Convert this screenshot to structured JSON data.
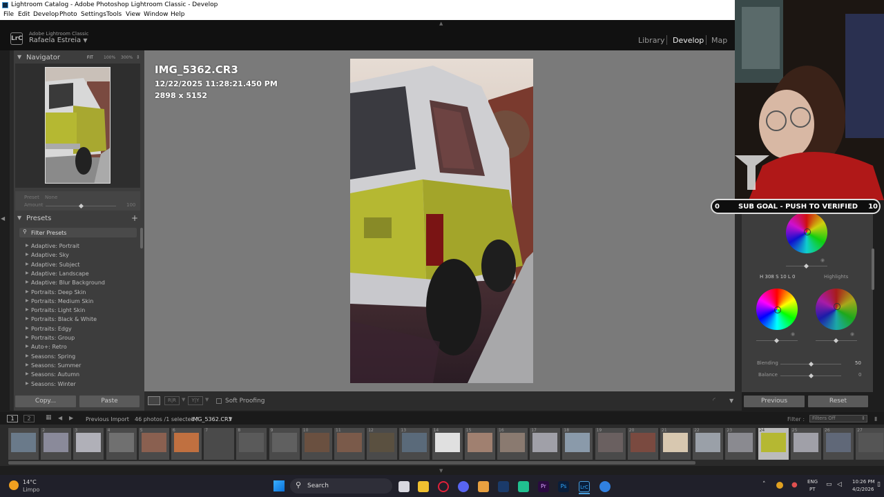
{
  "window": {
    "title": "Lightroom Catalog - Adobe Photoshop Lightroom Classic - Develop"
  },
  "menu": [
    "File",
    "Edit",
    "Develop",
    "Photo",
    "Settings",
    "Tools",
    "View",
    "Window",
    "Help"
  ],
  "identity": {
    "logo": "LrC",
    "product": "Adobe Lightroom Classic",
    "user": "Rafaela Estreia"
  },
  "modules": [
    "Library",
    "Develop",
    "Map"
  ],
  "navigator": {
    "title": "Navigator",
    "zoom": [
      "FIT",
      "100%",
      "300%"
    ]
  },
  "preset_amount": {
    "preset_label": "Preset",
    "preset_value": "None",
    "amount_label": "Amount",
    "amount_value": "100"
  },
  "presets": {
    "title": "Presets",
    "filter_label": "Filter Presets",
    "items": [
      "Adaptive: Portrait",
      "Adaptive: Sky",
      "Adaptive: Subject",
      "Adaptive: Landscape",
      "Adaptive: Blur Background",
      "Portraits: Deep Skin",
      "Portraits: Medium Skin",
      "Portraits: Light Skin",
      "Portraits: Black & White",
      "Portraits: Edgy",
      "Portraits: Group",
      "Auto+: Retro",
      "Seasons: Spring",
      "Seasons: Summer",
      "Seasons: Autumn",
      "Seasons: Winter"
    ]
  },
  "left_buttons": {
    "copy": "Copy...",
    "paste": "Paste"
  },
  "photo_info": {
    "filename": "IMG_5362.CR3",
    "datetime": "12/22/2025 11:28:21.450 PM",
    "dimensions": "2898 x 5152"
  },
  "toolbar": {
    "soft_proofing": "Soft Proofing"
  },
  "color_grading": {
    "hsl_readout": "H 308 S 10 L 0",
    "highlights_label": "Highlights",
    "blending_label": "Blending",
    "blending_value": "50",
    "balance_label": "Balance",
    "balance_value": "0"
  },
  "right_buttons": {
    "previous": "Previous",
    "reset": "Reset"
  },
  "filmbar": {
    "view1": "1",
    "view2": "2",
    "source": "Previous Import",
    "count": "46 photos /1 selected /",
    "current_file": "IMG_5362.CR3",
    "filter_label": "Filter :",
    "filter_value": "Filters Off"
  },
  "filmstrip_numbers": [
    "",
    "2",
    "3",
    "4",
    "5",
    "6",
    "7",
    "8",
    "9",
    "10",
    "11",
    "12",
    "13",
    "14",
    "15",
    "16",
    "17",
    "18",
    "19",
    "20",
    "21",
    "22",
    "23",
    "24",
    "25",
    "26",
    "27"
  ],
  "overlay": {
    "subgoal_left": "0",
    "subgoal_text": "SUB GOAL - PUSH TO VERIFIED",
    "subgoal_right": "10"
  },
  "taskbar": {
    "temp": "14°C",
    "weather": "Limpo",
    "search": "Search",
    "lang": "ENG",
    "lang2": "PT",
    "time": "10:26 PM",
    "date": "4/2/2026"
  },
  "colors": {
    "panel": "#3d3d3d",
    "center_bg": "#7a7a7a",
    "truck_yellow": "#b5b832",
    "taskbar": "#20202a"
  }
}
